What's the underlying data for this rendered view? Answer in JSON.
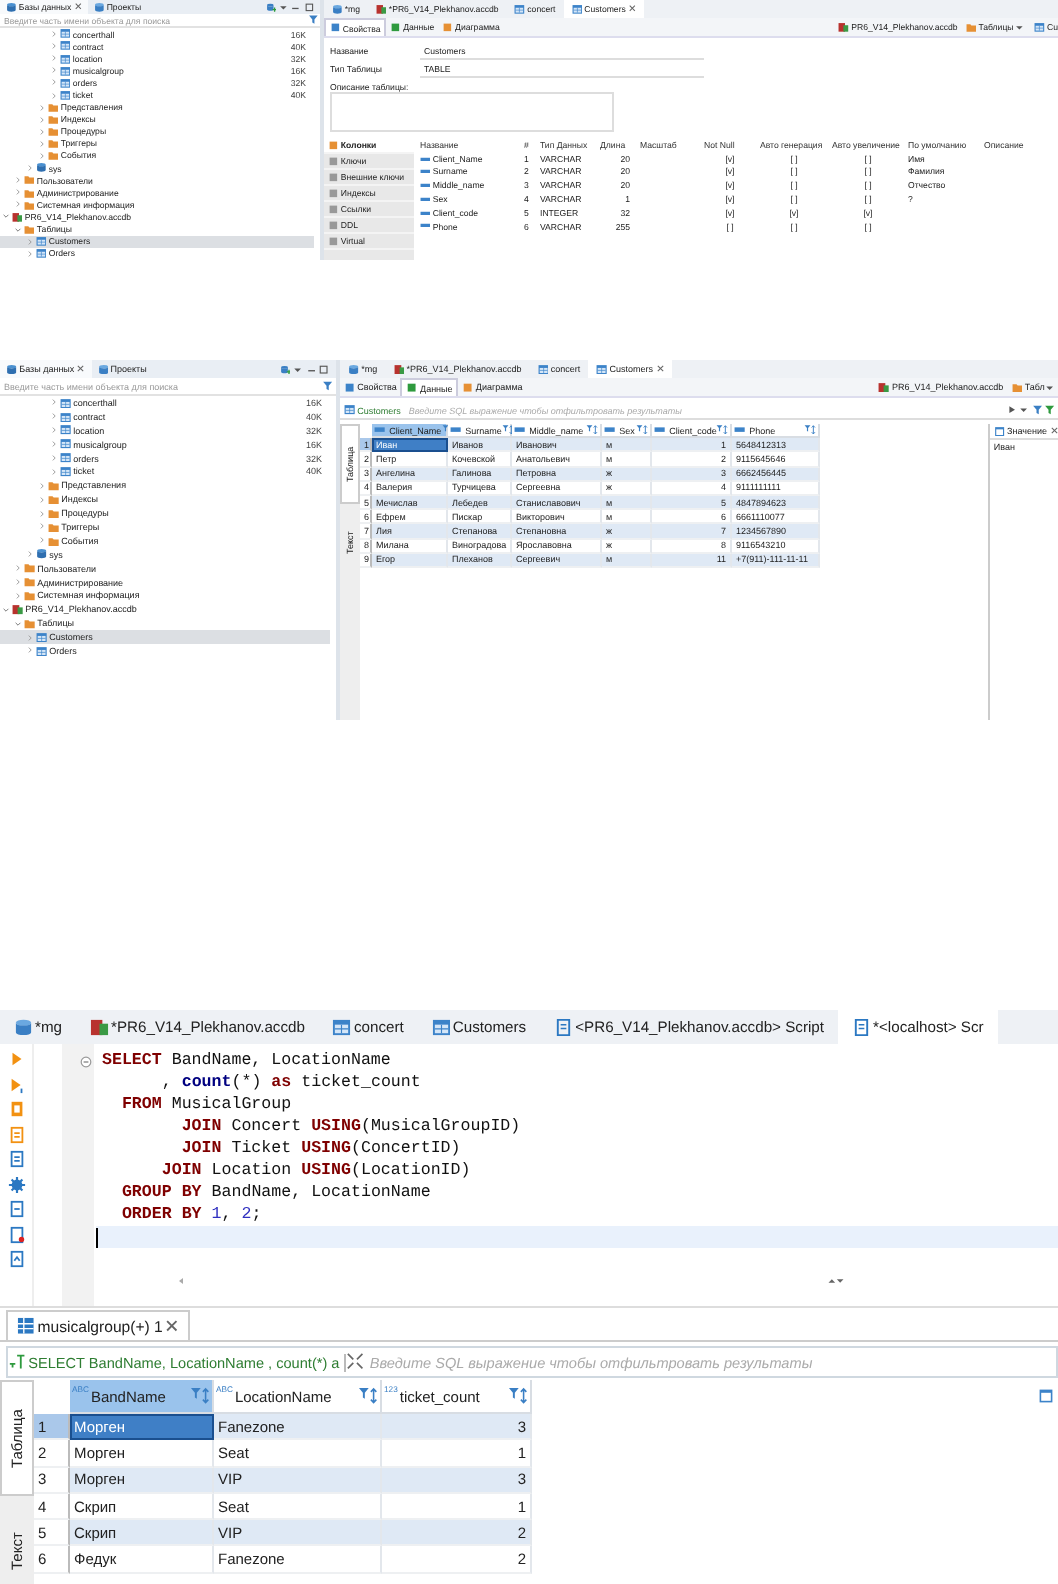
{
  "screens": [
    {
      "kind": "table_properties",
      "navigator": {
        "tabs": [
          {
            "label": "Базы данных",
            "selected": true,
            "closable": true
          },
          {
            "label": "Проекты",
            "selected": false,
            "closable": false
          }
        ],
        "search": {
          "placeholder": "Введите часть имени объекта для поиска"
        },
        "tree": [
          {
            "children": [
              {
                "children": [
                  {
                    "children": [
                      {
                        "children": [
                          {
                            "label": "concerthall",
                            "kind": "table",
                            "size": "16K",
                            "expanded": false,
                            "selected": false
                          },
                          {
                            "label": "contract",
                            "kind": "table",
                            "size": "40K",
                            "expanded": false,
                            "selected": false
                          },
                          {
                            "label": "location",
                            "kind": "table",
                            "size": "32K",
                            "expanded": false,
                            "selected": false
                          },
                          {
                            "label": "musicalgroup",
                            "kind": "table",
                            "size": "16K",
                            "expanded": false,
                            "selected": false
                          },
                          {
                            "label": "orders",
                            "kind": "table",
                            "size": "32K",
                            "expanded": false,
                            "selected": false
                          },
                          {
                            "label": "ticket",
                            "kind": "table",
                            "size": "40K",
                            "expanded": false,
                            "selected": false
                          }
                        ]
                      },
                      {
                        "label": "Представления",
                        "kind": "folder",
                        "expanded": false,
                        "selected": false
                      },
                      {
                        "label": "Индексы",
                        "kind": "folder",
                        "expanded": false,
                        "selected": false
                      },
                      {
                        "label": "Процедуры",
                        "kind": "folder",
                        "expanded": false,
                        "selected": false
                      },
                      {
                        "label": "Триггеры",
                        "kind": "folder",
                        "expanded": false,
                        "selected": false
                      },
                      {
                        "label": "События",
                        "kind": "folder",
                        "expanded": false,
                        "selected": false
                      }
                    ]
                  },
                  {
                    "label": "sys",
                    "kind": "schema",
                    "expanded": false,
                    "selected": false
                  }
                ]
              },
              {
                "label": "Пользователи",
                "kind": "folder",
                "expanded": false,
                "selected": false
              },
              {
                "label": "Администрирование",
                "kind": "folder",
                "expanded": false,
                "selected": false
              },
              {
                "label": "Системная информация",
                "kind": "folder",
                "expanded": false,
                "selected": false
              }
            ]
          },
          {
            "label": "PR6_V14_Plekhanov.accdb",
            "kind": "file",
            "expanded": true,
            "selected": false,
            "children": [
              {
                "label": "Таблицы",
                "kind": "folder",
                "expanded": true,
                "selected": false,
                "children": [
                  {
                    "label": "Customers",
                    "kind": "table",
                    "expanded": false,
                    "selected": true
                  },
                  {
                    "label": "Orders",
                    "kind": "table",
                    "expanded": false,
                    "selected": false
                  }
                ]
              }
            ]
          }
        ]
      },
      "editor_tabs": [
        {
          "label": "*mg",
          "kind": "connection",
          "selected": false,
          "closable": false
        },
        {
          "label": "*PR6_V14_Plekhanov.accdb",
          "kind": "file",
          "selected": false,
          "closable": false
        },
        {
          "label": "concert",
          "kind": "table",
          "selected": false,
          "closable": false
        },
        {
          "label": "Customers",
          "kind": "table",
          "selected": true,
          "closable": true
        }
      ],
      "sub_tabs": [
        {
          "label": "Свойства",
          "selected": true
        },
        {
          "label": "Данные",
          "selected": false
        },
        {
          "label": "Диаграмма",
          "selected": false
        }
      ],
      "breadcrumb": [
        {
          "label": "PR6_V14_Plekhanov.accdb",
          "kind": "file"
        },
        {
          "label": "Таблицы",
          "kind": "folder"
        },
        {
          "label": "Cu",
          "kind": "table"
        }
      ],
      "fields": [
        {
          "label": "Название",
          "value": "Customers",
          "kind": "text"
        },
        {
          "label": "Тип Таблицы",
          "value": "TABLE",
          "kind": "text"
        },
        {
          "label": "Описание таблицы:",
          "kind": "textarea"
        }
      ],
      "sections": [
        {
          "label": "Колонки",
          "selected": true
        },
        {
          "label": "Ключи",
          "selected": false
        },
        {
          "label": "Внешние ключи",
          "selected": false
        },
        {
          "label": "Индексы",
          "selected": false
        },
        {
          "label": "Ссылки",
          "selected": false
        },
        {
          "label": "DDL",
          "selected": false
        },
        {
          "label": "Virtual",
          "selected": false
        }
      ],
      "columns_table": {
        "columns": [
          "Название",
          "#",
          "Тип Данных",
          "Длина",
          "Масштаб",
          "Not Null",
          "Авто генерация",
          "Авто увеличение",
          "По умолчанию",
          "Описание"
        ],
        "rows": [
          [
            "Client_Name",
            "1",
            "VARCHAR",
            "20",
            null,
            "[v]",
            "[ ]",
            "[ ]",
            "Имя",
            null
          ],
          [
            "Surname",
            "2",
            "VARCHAR",
            "20",
            null,
            "[v]",
            "[ ]",
            "[ ]",
            "Фамилия",
            null
          ],
          [
            "Middle_name",
            "3",
            "VARCHAR",
            "20",
            null,
            "[v]",
            "[ ]",
            "[ ]",
            "Отчество",
            null
          ],
          [
            "Sex",
            "4",
            "VARCHAR",
            "1",
            null,
            "[v]",
            "[ ]",
            "[ ]",
            "?",
            null
          ],
          [
            "Client_code",
            "5",
            "INTEGER",
            "32",
            null,
            "[v]",
            "[v]",
            "[v]",
            null,
            null
          ],
          [
            "Phone",
            "6",
            "VARCHAR",
            "255",
            null,
            "[ ]",
            "[ ]",
            "[ ]",
            null,
            null
          ]
        ]
      }
    },
    {
      "kind": "table_data",
      "navigator": {
        "tabs": [
          {
            "label": "Базы данных",
            "selected": true,
            "closable": true
          },
          {
            "label": "Проекты",
            "selected": false,
            "closable": false
          }
        ],
        "search": {
          "placeholder": "Введите часть имени объекта для поиска"
        },
        "tree": [
          {
            "children": [
              {
                "children": [
                  {
                    "children": [
                      {
                        "children": [
                          {
                            "label": "concerthall",
                            "kind": "table",
                            "size": "16K",
                            "expanded": false,
                            "selected": false
                          },
                          {
                            "label": "contract",
                            "kind": "table",
                            "size": "40K",
                            "expanded": false,
                            "selected": false
                          },
                          {
                            "label": "location",
                            "kind": "table",
                            "size": "32K",
                            "expanded": false,
                            "selected": false
                          },
                          {
                            "label": "musicalgroup",
                            "kind": "table",
                            "size": "16K",
                            "expanded": false,
                            "selected": false
                          },
                          {
                            "label": "orders",
                            "kind": "table",
                            "size": "32K",
                            "expanded": false,
                            "selected": false
                          },
                          {
                            "label": "ticket",
                            "kind": "table",
                            "size": "40K",
                            "expanded": false,
                            "selected": false
                          }
                        ]
                      },
                      {
                        "label": "Представления",
                        "kind": "folder",
                        "expanded": false,
                        "selected": false
                      },
                      {
                        "label": "Индексы",
                        "kind": "folder",
                        "expanded": false,
                        "selected": false
                      },
                      {
                        "label": "Процедуры",
                        "kind": "folder",
                        "expanded": false,
                        "selected": false
                      },
                      {
                        "label": "Триггеры",
                        "kind": "folder",
                        "expanded": false,
                        "selected": false
                      },
                      {
                        "label": "События",
                        "kind": "folder",
                        "expanded": false,
                        "selected": false
                      }
                    ]
                  },
                  {
                    "label": "sys",
                    "kind": "schema",
                    "expanded": false,
                    "selected": false
                  }
                ]
              },
              {
                "label": "Пользователи",
                "kind": "folder",
                "expanded": false,
                "selected": false
              },
              {
                "label": "Администрирование",
                "kind": "folder",
                "expanded": false,
                "selected": false
              },
              {
                "label": "Системная информация",
                "kind": "folder",
                "expanded": false,
                "selected": false
              }
            ]
          },
          {
            "label": "PR6_V14_Plekhanov.accdb",
            "kind": "file",
            "expanded": true,
            "selected": false,
            "children": [
              {
                "label": "Таблицы",
                "kind": "folder",
                "expanded": true,
                "selected": false,
                "children": [
                  {
                    "label": "Customers",
                    "kind": "table",
                    "expanded": false,
                    "selected": true
                  },
                  {
                    "label": "Orders",
                    "kind": "table",
                    "expanded": false,
                    "selected": false
                  }
                ]
              }
            ]
          }
        ]
      },
      "editor_tabs": [
        {
          "label": "*mg",
          "kind": "connection",
          "selected": false,
          "closable": false
        },
        {
          "label": "*PR6_V14_Plekhanov.accdb",
          "kind": "file",
          "selected": false,
          "closable": false
        },
        {
          "label": "concert",
          "kind": "table",
          "selected": false,
          "closable": false
        },
        {
          "label": "Customers",
          "kind": "table",
          "selected": true,
          "closable": true
        }
      ],
      "sub_tabs": [
        {
          "label": "Свойства",
          "selected": false
        },
        {
          "label": "Данные",
          "selected": true
        },
        {
          "label": "Диаграмма",
          "selected": false
        }
      ],
      "breadcrumb": [
        {
          "label": "PR6_V14_Plekhanov.accdb",
          "kind": "file"
        },
        {
          "label": "Табл",
          "kind": "folder"
        }
      ],
      "filter": {
        "table": "Customers",
        "placeholder": "Введите SQL выражение чтобы отфильтровать результаты"
      },
      "view_tabs": [
        {
          "label": "Таблица",
          "selected": true
        },
        {
          "label": "Текст",
          "selected": false
        }
      ],
      "grid": {
        "columns": [
          {
            "name": "Client_Name",
            "kind": "text",
            "selected": true
          },
          {
            "name": "Surname",
            "kind": "text",
            "selected": false
          },
          {
            "name": "Middle_name",
            "kind": "text",
            "selected": false
          },
          {
            "name": "Sex",
            "kind": "text",
            "selected": false
          },
          {
            "name": "Client_code",
            "kind": "number",
            "selected": false
          },
          {
            "name": "Phone",
            "kind": "text",
            "selected": false
          }
        ],
        "rows": [
          {
            "number": "1",
            "selected": true,
            "cells": [
              "Иван",
              "Иванов",
              "Иванович",
              "м",
              "1",
              "5648412313"
            ]
          },
          {
            "number": "2",
            "selected": false,
            "cells": [
              "Петр",
              "Кочевской",
              "Анатольевич",
              "м",
              "2",
              "9115645646"
            ]
          },
          {
            "number": "3",
            "selected": false,
            "cells": [
              "Ангелина",
              "Галинова",
              "Петровна",
              "ж",
              "3",
              "6662456445"
            ]
          },
          {
            "number": "4",
            "selected": false,
            "cells": [
              "Валерия",
              "Турчицева",
              "Сергеевна",
              "ж",
              "4",
              "9111111111"
            ]
          },
          {
            "number": "5",
            "selected": false,
            "cells": [
              "Мечислав",
              "Лебедев",
              "Станиславович",
              "м",
              "5",
              "4847894623"
            ]
          },
          {
            "number": "6",
            "selected": false,
            "cells": [
              "Ефрем",
              "Пискар",
              "Викторович",
              "м",
              "6",
              "6661110077"
            ]
          },
          {
            "number": "7",
            "selected": false,
            "cells": [
              "Лия",
              "Степанова",
              "Степановна",
              "ж",
              "7",
              "1234567890"
            ]
          },
          {
            "number": "8",
            "selected": false,
            "cells": [
              "Милана",
              "Виноградова",
              "Ярославовна",
              "ж",
              "8",
              "9116543210"
            ]
          },
          {
            "number": "9",
            "selected": false,
            "cells": [
              "Егор",
              "Плеханов",
              "Сергеевич",
              "м",
              "11",
              "+7(911)-111-11-11"
            ]
          }
        ]
      },
      "value_panel": {
        "title": "Значение",
        "value": "Иван"
      }
    },
    {
      "kind": "sql_editor",
      "editor_tabs": [
        {
          "label": "*mg",
          "kind": "connection",
          "selected": false,
          "closable": false
        },
        {
          "label": "*PR6_V14_Plekhanov.accdb",
          "kind": "file",
          "selected": false,
          "closable": false
        },
        {
          "label": "concert",
          "kind": "table",
          "selected": false,
          "closable": false
        },
        {
          "label": "Customers",
          "kind": "table",
          "selected": false,
          "closable": false
        },
        {
          "label": "<PR6_V14_Plekhanov.accdb> Script",
          "kind": "script",
          "selected": false,
          "closable": false
        },
        {
          "label": "*<localhost> Scr",
          "kind": "script",
          "selected": true,
          "closable": false
        }
      ],
      "code": [
        [
          {
            "kind": "keyword",
            "text": "SELECT"
          },
          {
            "kind": "plain",
            "text": " BandName, LocationName"
          }
        ],
        [
          {
            "kind": "plain",
            "text": "      , "
          },
          {
            "kind": "function",
            "text": "count"
          },
          {
            "kind": "plain",
            "text": "(*) "
          },
          {
            "kind": "keyword",
            "text": "as"
          },
          {
            "kind": "plain",
            "text": " ticket_count"
          }
        ],
        [
          {
            "kind": "keyword",
            "text": "  FROM"
          },
          {
            "kind": "plain",
            "text": " MusicalGroup"
          }
        ],
        [
          {
            "kind": "keyword",
            "text": "        JOIN"
          },
          {
            "kind": "plain",
            "text": " Concert "
          },
          {
            "kind": "keyword",
            "text": "USING"
          },
          {
            "kind": "plain",
            "text": "(MusicalGroupID)"
          }
        ],
        [
          {
            "kind": "keyword",
            "text": "        JOIN"
          },
          {
            "kind": "plain",
            "text": " Ticket "
          },
          {
            "kind": "keyword",
            "text": "USING"
          },
          {
            "kind": "plain",
            "text": "(ConcertID)"
          }
        ],
        [
          {
            "kind": "keyword",
            "text": "      JOIN"
          },
          {
            "kind": "plain",
            "text": " Location "
          },
          {
            "kind": "keyword",
            "text": "USING"
          },
          {
            "kind": "plain",
            "text": "(LocationID)"
          }
        ],
        [
          {
            "kind": "keyword",
            "text": "  GROUP BY"
          },
          {
            "kind": "plain",
            "text": " BandName, LocationName"
          }
        ],
        [
          {
            "kind": "keyword",
            "text": "  ORDER BY "
          },
          {
            "kind": "number",
            "text": "1"
          },
          {
            "kind": "plain",
            "text": ", "
          },
          {
            "kind": "number",
            "text": "2"
          },
          {
            "kind": "plain",
            "text": ";"
          }
        ]
      ],
      "result_tab": {
        "label": "musicalgroup(+) 1",
        "closable": true
      },
      "filter": {
        "query": "SELECT BandName, LocationName , count(*) a",
        "placeholder": "Введите SQL выражение чтобы отфильтровать результаты"
      },
      "view_tabs": [
        {
          "label": "Таблица",
          "selected": true
        },
        {
          "label": "Текст",
          "selected": false
        }
      ],
      "grid": {
        "columns": [
          {
            "name": "BandName",
            "type": "ABC",
            "kind": "text",
            "selected": true
          },
          {
            "name": "LocationName",
            "type": "ABC",
            "kind": "text",
            "selected": false
          },
          {
            "name": "ticket_count",
            "type": "123",
            "kind": "number",
            "selected": false
          }
        ],
        "rows": [
          {
            "number": "1",
            "selected": true,
            "cells": [
              "Морген",
              "Fanezone",
              "3"
            ]
          },
          {
            "number": "2",
            "selected": false,
            "cells": [
              "Морген",
              "Seat",
              "1"
            ]
          },
          {
            "number": "3",
            "selected": false,
            "cells": [
              "Морген",
              "VIP",
              "3"
            ]
          },
          {
            "number": "4",
            "selected": false,
            "cells": [
              "Скрип",
              "Seat",
              "1"
            ]
          },
          {
            "number": "5",
            "selected": false,
            "cells": [
              "Скрип",
              "VIP",
              "2"
            ]
          },
          {
            "number": "6",
            "selected": false,
            "cells": [
              "Федук",
              "Fanezone",
              "2"
            ]
          }
        ]
      }
    }
  ]
}
